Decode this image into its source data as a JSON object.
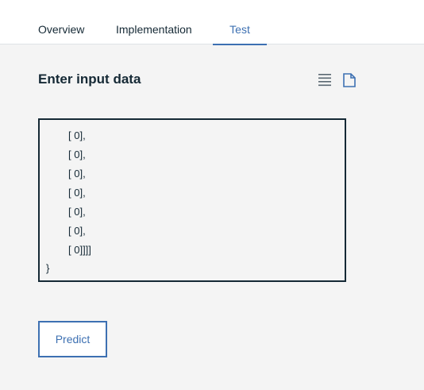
{
  "tabs": {
    "overview": "Overview",
    "implementation": "Implementation",
    "test": "Test"
  },
  "section": {
    "title": "Enter input data",
    "icons": [
      "list-view-icon",
      "file-icon"
    ]
  },
  "editor": {
    "lines": [
      "[ 0],",
      "[ 0],",
      "[ 0],",
      "[ 0],",
      "[ 0],",
      "[ 0],",
      "[ 0]]]]",
      "}"
    ]
  },
  "actions": {
    "predict_label": "Predict"
  },
  "colors": {
    "accent": "#3d70b2",
    "text": "#152935",
    "background": "#f4f4f4"
  }
}
